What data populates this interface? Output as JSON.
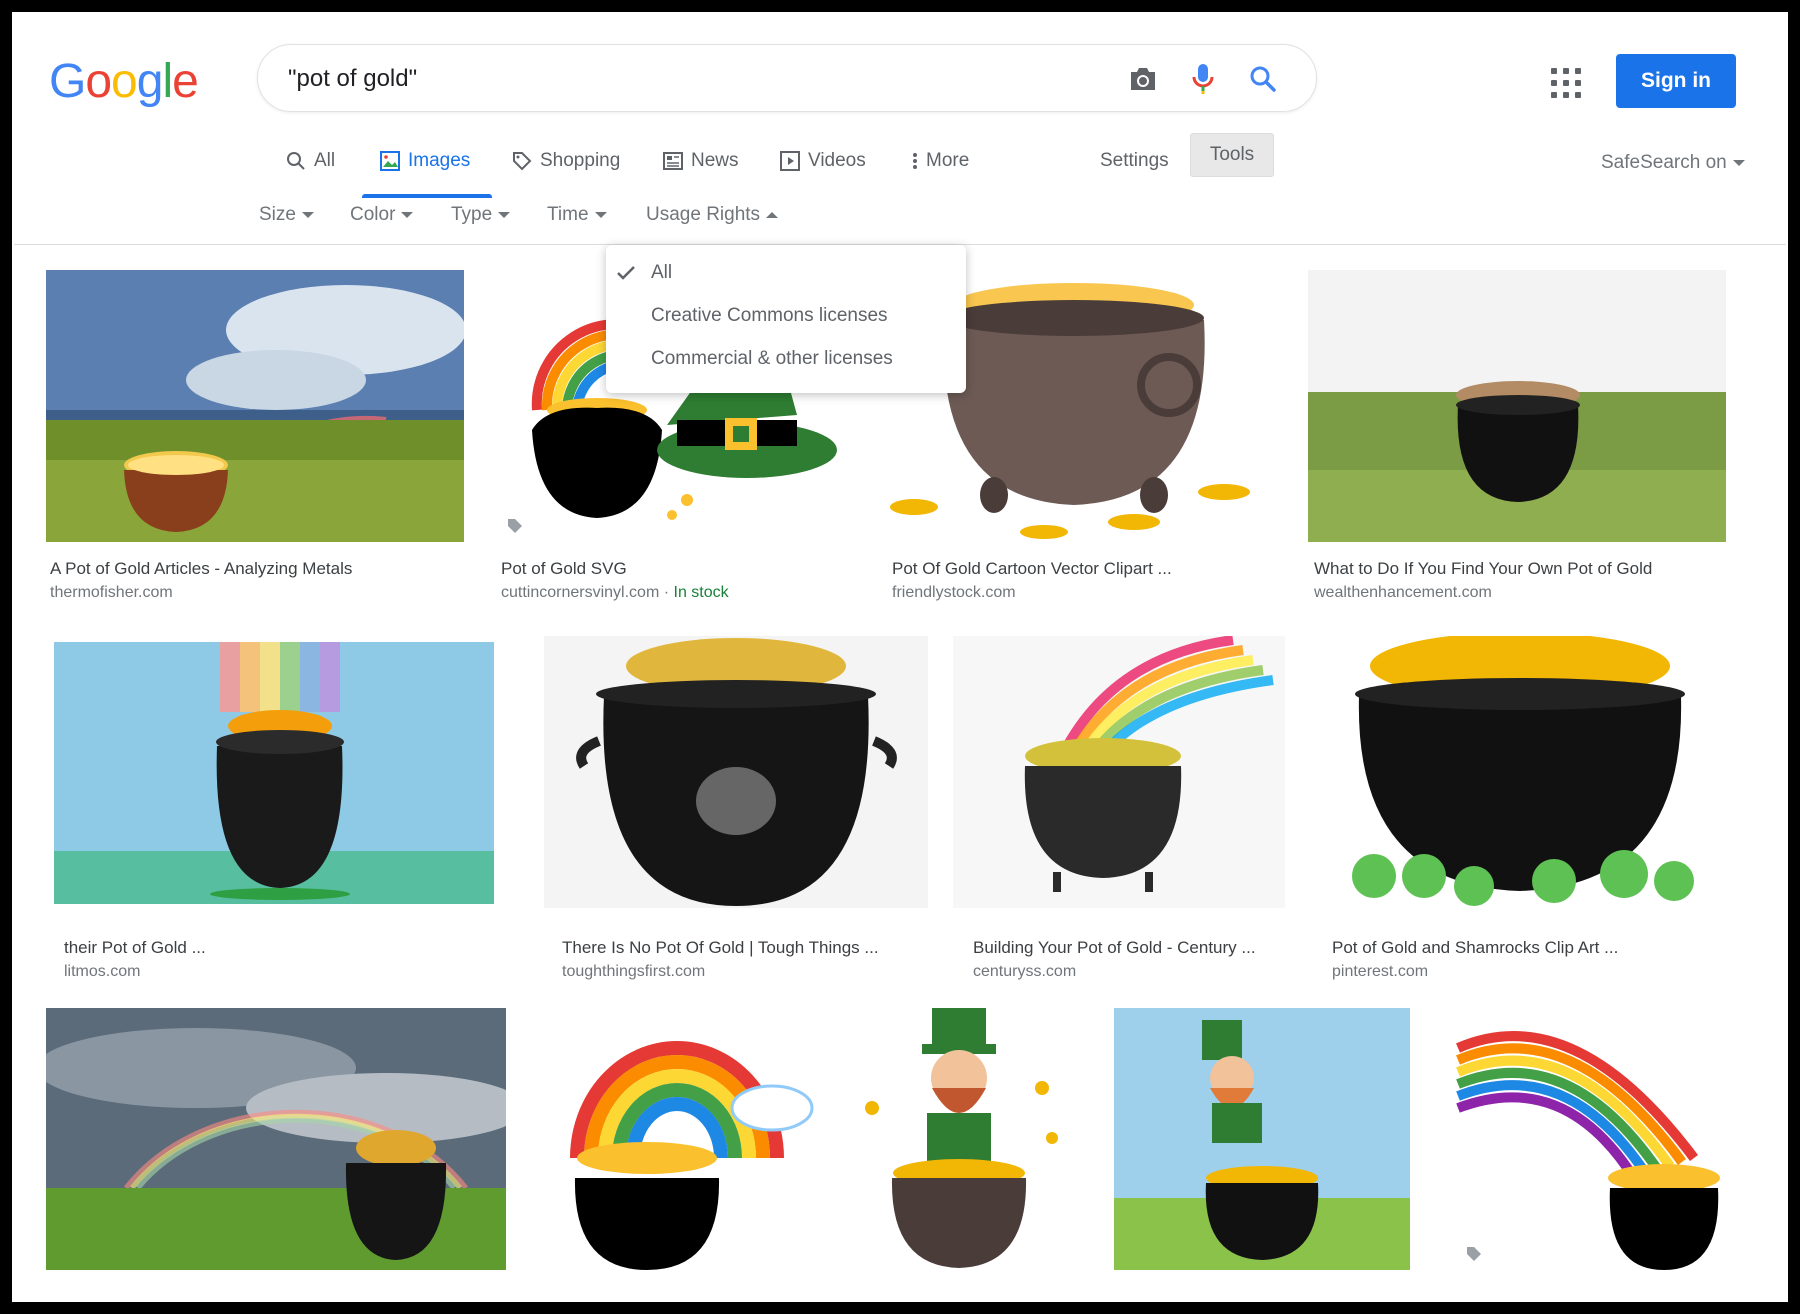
{
  "logo": {
    "letters": [
      "G",
      "o",
      "o",
      "g",
      "l",
      "e"
    ],
    "colors": [
      "#4285F4",
      "#EA4335",
      "#FBBC05",
      "#4285F4",
      "#34A853",
      "#EA4335"
    ]
  },
  "search": {
    "value": "\"pot of gold\""
  },
  "header": {
    "signin_label": "Sign in"
  },
  "tabs": [
    {
      "label": "All",
      "icon": "search-icon"
    },
    {
      "label": "Images",
      "icon": "image-icon"
    },
    {
      "label": "Shopping",
      "icon": "tag-icon"
    },
    {
      "label": "News",
      "icon": "news-icon"
    },
    {
      "label": "Videos",
      "icon": "play-icon"
    },
    {
      "label": "More",
      "icon": "more-vert-icon"
    }
  ],
  "toolbar": {
    "settings_label": "Settings",
    "tools_label": "Tools",
    "safesearch_label": "SafeSearch on"
  },
  "filters": [
    {
      "label": "Size"
    },
    {
      "label": "Color"
    },
    {
      "label": "Type"
    },
    {
      "label": "Time"
    },
    {
      "label": "Usage Rights"
    }
  ],
  "usage_dropdown": {
    "items": [
      {
        "label": "All",
        "selected": true
      },
      {
        "label": "Creative Commons licenses"
      },
      {
        "label": "Commercial & other licenses"
      }
    ]
  },
  "colors": {
    "accent": "#1a73e8",
    "stock_green": "#188038",
    "muted": "#70757a"
  },
  "results": [
    {
      "title": "A Pot of Gold Articles - Analyzing Metals",
      "source": "thermofisher.com"
    },
    {
      "title": "Pot of Gold SVG",
      "source": "cuttincornersvinyl.com",
      "stock": "In stock"
    },
    {
      "title": "Pot Of Gold Cartoon Vector Clipart ...",
      "source": "friendlystock.com"
    },
    {
      "title": "What to Do If You Find Your Own Pot of Gold",
      "source": "wealthenhancement.com"
    },
    {
      "title": "their Pot of Gold ...",
      "source": "litmos.com"
    },
    {
      "title": "There Is No Pot Of Gold | Tough Things ...",
      "source": "toughthingsfirst.com"
    },
    {
      "title": "Building Your Pot of Gold - Century ...",
      "source": "centuryss.com"
    },
    {
      "title": "Pot of Gold and Shamrocks Clip Art ...",
      "source": "pinterest.com"
    }
  ]
}
